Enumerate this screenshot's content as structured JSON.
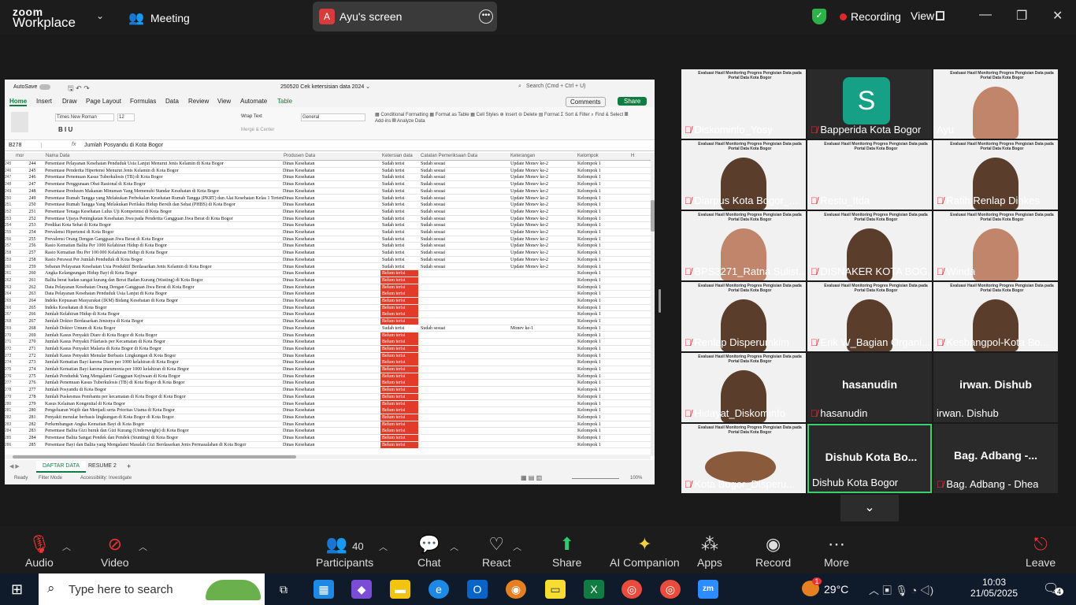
{
  "zoom": {
    "logo_line1": "zoom",
    "logo_line2": "Workplace",
    "meeting_label": "Meeting",
    "screen_label": "Ayu's screen",
    "screen_avatar": "A",
    "recording_label": "Recording",
    "view_label": "View"
  },
  "excel": {
    "autosave": "AutoSave",
    "file_title": "250520 Cek ketersisian data 2024 ⌄",
    "search": "Search (Cmd + Ctrl + U)",
    "tabs": [
      "Home",
      "Insert",
      "Draw",
      "Page Layout",
      "Formulas",
      "Data",
      "Review",
      "View",
      "Automate",
      "Table"
    ],
    "comments": "Comments",
    "share": "Share",
    "font_name": "Times New Roman",
    "font_size": "12",
    "wrap_text": "Wrap Text",
    "merge": "Merge & Center",
    "number_format": "General",
    "cell_ref": "B278",
    "formula": "Jumlah Posyandu di Kota Bogor",
    "col_headers": [
      "mor",
      "Nama Data",
      "Produsen Data",
      "Ketersian data",
      "Catatan Pemeriksaan Data",
      "Keterangan",
      "Kelompok",
      "H"
    ],
    "rows": [
      {
        "rn": "245",
        "no": "244",
        "nm": "Persentase Pelayanan Kesehatan Penduduk Usia Lanjut Menurut Jenis Kelamin di Kota Bogor",
        "pd": "Dinas Kesehatan",
        "kt": "Sudah terisi",
        "ct": "Sudah sesuai",
        "kg": "Update Monev ke-2",
        "kl": "Kelompok 1"
      },
      {
        "rn": "246",
        "no": "245",
        "nm": "Persentase Penderita Hipertensi Menurut Jenis Kelamin di Kota Bogor",
        "pd": "Dinas Kesehatan",
        "kt": "Sudah terisi",
        "ct": "Sudah sesuai",
        "kg": "Update Monev ke-2",
        "kl": "Kelompok 1"
      },
      {
        "rn": "247",
        "no": "246",
        "nm": "Persentase Penemuan Kasus Tuberkulosis (TB) di Kota Bogor",
        "pd": "Dinas Kesehatan",
        "kt": "Sudah terisi",
        "ct": "Sudah sesuai",
        "kg": "Update Monev ke-2",
        "kl": "Kelompok 1"
      },
      {
        "rn": "248",
        "no": "247",
        "nm": "Persentase Penggunaan Obat Rasional di Kota Bogor",
        "pd": "Dinas Kesehatan",
        "kt": "Sudah terisi",
        "ct": "Sudah sesuai",
        "kg": "Update Monev ke-2",
        "kl": "Kelompok 1"
      },
      {
        "rn": "249",
        "no": "248",
        "nm": "Persentase Produsen Makanan Minuman Yang Memenuhi Standar Kesehatan di Kota Bogor",
        "pd": "Dinas Kesehatan",
        "kt": "Sudah terisi",
        "ct": "Sudah sesuai",
        "kg": "Update Monev ke-2",
        "kl": "Kelompok 1"
      },
      {
        "rn": "250",
        "no": "249",
        "nm": "Persentase Rumah Tangga yang Melakukan Perbekalan Kesehatan Rumah Tangga (PKRT) dan Alat Kesehatan Kelas 1 Tertentu Yang Men",
        "pd": "Dinas Kesehatan",
        "kt": "Sudah terisi",
        "ct": "Sudah sesuai",
        "kg": "Update Monev ke-2",
        "kl": "Kelompok 1"
      },
      {
        "rn": "251",
        "no": "250",
        "nm": "Persentase Rumah Tangga Yang Melakukan Perilaku Hidup Bersih dan Sehat (PHBS) di Kota Bogor",
        "pd": "Dinas Kesehatan",
        "kt": "Sudah terisi",
        "ct": "Sudah sesuai",
        "kg": "Update Monev ke-2",
        "kl": "Kelompok 1"
      },
      {
        "rn": "252",
        "no": "251",
        "nm": "Persentase Tenaga Kesehatan Lulus Uji Kompetensi di Kota Bogor",
        "pd": "Dinas Kesehatan",
        "kt": "Sudah terisi",
        "ct": "Sudah sesuai",
        "kg": "Update Monev ke-2",
        "kl": "Kelompok 1"
      },
      {
        "rn": "253",
        "no": "252",
        "nm": "Persentase Upaya Peningkatan Kesehatan Jiwa pada Penderita Gangguan Jiwa Berat di Kota Bogor",
        "pd": "Dinas Kesehatan",
        "kt": "Sudah terisi",
        "ct": "Sudah sesuai",
        "kg": "Update Monev ke-2",
        "kl": "Kelompok 1"
      },
      {
        "rn": "254",
        "no": "253",
        "nm": "Predikat Kota Sehat di Kota Bogor",
        "pd": "Dinas Kesehatan",
        "kt": "Sudah terisi",
        "ct": "Sudah sesuai",
        "kg": "Update Monev ke-2",
        "kl": "Kelompok 1"
      },
      {
        "rn": "255",
        "no": "254",
        "nm": "Prevalensi Hipertensi di Kota Bogor",
        "pd": "Dinas Kesehatan",
        "kt": "Sudah terisi",
        "ct": "Sudah sesuai",
        "kg": "Update Monev ke-2",
        "kl": "Kelompok 1"
      },
      {
        "rn": "256",
        "no": "255",
        "nm": "Prevalensi Orang Dengan Gangguan Jiwa Berat di Kota Bogor",
        "pd": "Dinas Kesehatan",
        "kt": "Sudah terisi",
        "ct": "Sudah sesuai",
        "kg": "Update Monev ke-2",
        "kl": "Kelompok 1"
      },
      {
        "rn": "257",
        "no": "256",
        "nm": "Rasio Kematian Balita Per 1000 Kelahiran Hidup di Kota Bogor",
        "pd": "Dinas Kesehatan",
        "kt": "Sudah terisi",
        "ct": "Sudah sesuai",
        "kg": "Update Monev ke-2",
        "kl": "Kelompok 1"
      },
      {
        "rn": "258",
        "no": "257",
        "nm": "Rasio Kematian Ibu Per 100.000 Kelahiran Hidup di Kota Bogor",
        "pd": "Dinas Kesehatan",
        "kt": "Sudah terisi",
        "ct": "Sudah sesuai",
        "kg": "Update Monev ke-2",
        "kl": "Kelompok 1"
      },
      {
        "rn": "259",
        "no": "258",
        "nm": "Rasio Perawat Per Jumlah Penduduk di Kota Bogor",
        "pd": "Dinas Kesehatan",
        "kt": "Sudah terisi",
        "ct": "Sudah sesuai",
        "kg": "Update Monev ke-2",
        "kl": "Kelompok 1"
      },
      {
        "rn": "260",
        "no": "259",
        "nm": "Sebaran Pelayanan Kesehatan Usia Produktif Berdasarkan Jenis Kelamin di Kota Bogor",
        "pd": "Dinas Kesehatan",
        "kt": "Sudah terisi",
        "ct": "Sudah sesuai",
        "kg": "Update Monev ke-2",
        "kl": "Kelompok 1"
      },
      {
        "rn": "261",
        "no": "260",
        "nm": "Angka Kelangsungan Hidup Bayi di Kota Bogor",
        "pd": "Dinas Kesehatan",
        "kt": "Belum terisi",
        "ct": "",
        "kg": "",
        "kl": "Kelompok 1"
      },
      {
        "rn": "262",
        "no": "261",
        "nm": "Balita berat badan sangat kurang dan Berat Badan Kurang (Wasting) di Kota Bogor",
        "pd": "Dinas Kesehatan",
        "kt": "Belum terisi",
        "ct": "",
        "kg": "",
        "kl": "Kelompok 1"
      },
      {
        "rn": "263",
        "no": "262",
        "nm": "Data Pelayanan Kesehatan Orang Dengan Gangguan Jiwa Berat di Kota Bogor",
        "pd": "Dinas Kesehatan",
        "kt": "Belum terisi",
        "ct": "",
        "kg": "",
        "kl": "Kelompok 1"
      },
      {
        "rn": "264",
        "no": "263",
        "nm": "Data Pelayanan Kesehatan Penduduk Usia Lanjut di Kota Bogor",
        "pd": "Dinas Kesehatan",
        "kt": "Belum terisi",
        "ct": "",
        "kg": "",
        "kl": "Kelompok 1"
      },
      {
        "rn": "265",
        "no": "264",
        "nm": "Indeks Kepuasan Masyarakat (IKM) Bidang Kesehatan di Kota Bogor",
        "pd": "Dinas Kesehatan",
        "kt": "Belum terisi",
        "ct": "",
        "kg": "",
        "kl": "Kelompok 1"
      },
      {
        "rn": "266",
        "no": "265",
        "nm": "Indeks Kesehatan di Kota Bogor",
        "pd": "Dinas Kesehatan",
        "kt": "Belum terisi",
        "ct": "",
        "kg": "",
        "kl": "Kelompok 1"
      },
      {
        "rn": "267",
        "no": "266",
        "nm": "Jumlah Kelahiran Hidup di Kota Bogor",
        "pd": "Dinas Kesehatan",
        "kt": "Belum terisi",
        "ct": "",
        "kg": "",
        "kl": "Kelompok 1"
      },
      {
        "rn": "268",
        "no": "267",
        "nm": "Jumlah Dokter Berdasarkan Jenisnya di Kota Bogor",
        "pd": "Dinas Kesehatan",
        "kt": "Belum terisi",
        "ct": "",
        "kg": "",
        "kl": "Kelompok 1"
      },
      {
        "rn": "269",
        "no": "268",
        "nm": "Jumlah Dokter Umum di Kota Bogor",
        "pd": "Dinas Kesehatan",
        "kt": "Sudah terisi",
        "ct": "Sudah sesuai",
        "kg": "Monev ke-1",
        "kl": "Kelompok 1"
      },
      {
        "rn": "270",
        "no": "269",
        "nm": "Jumlah Kasus Penyakit Diare di Kota Bogor di Kota Bogor",
        "pd": "Dinas Kesehatan",
        "kt": "Belum terisi",
        "ct": "",
        "kg": "",
        "kl": "Kelompok 1"
      },
      {
        "rn": "271",
        "no": "270",
        "nm": "Jumlah Kasus Penyakit Filariasis per Kecamatan di Kota Bogor",
        "pd": "Dinas Kesehatan",
        "kt": "Belum terisi",
        "ct": "",
        "kg": "",
        "kl": "Kelompok 1"
      },
      {
        "rn": "272",
        "no": "271",
        "nm": "Jumlah Kasus Penyakit Malaria di Kota Bogor di Kota Bogor",
        "pd": "Dinas Kesehatan",
        "kt": "Belum terisi",
        "ct": "",
        "kg": "",
        "kl": "Kelompok 1"
      },
      {
        "rn": "273",
        "no": "272",
        "nm": "Jumlah Kasus Penyakit Menular Berbasis Lingkungan di Kota Bogor",
        "pd": "Dinas Kesehatan",
        "kt": "Belum terisi",
        "ct": "",
        "kg": "",
        "kl": "Kelompok 1"
      },
      {
        "rn": "274",
        "no": "273",
        "nm": "Jumlah Kematian Bayi karena Diare per 1000 kelahiran di Kota Bogor",
        "pd": "Dinas Kesehatan",
        "kt": "Belum terisi",
        "ct": "",
        "kg": "",
        "kl": "Kelompok 1"
      },
      {
        "rn": "275",
        "no": "274",
        "nm": "Jumlah Kematian Bayi karena pneumonia per 1000 kelahiran di Kota Bogor",
        "pd": "Dinas Kesehatan",
        "kt": "Belum terisi",
        "ct": "",
        "kg": "",
        "kl": "Kelompok 1"
      },
      {
        "rn": "276",
        "no": "275",
        "nm": "Jumlah Penduduk Yang Mengalami Gangguan Kejiwaan di Kota Bogor",
        "pd": "Dinas Kesehatan",
        "kt": "Belum terisi",
        "ct": "",
        "kg": "",
        "kl": "Kelompok 1"
      },
      {
        "rn": "277",
        "no": "276",
        "nm": "Jumlah Penemuan Kasus Tuberkulosis (TB) di Kota Bogor di Kota Bogor",
        "pd": "Dinas Kesehatan",
        "kt": "Belum terisi",
        "ct": "",
        "kg": "",
        "kl": "Kelompok 1"
      },
      {
        "rn": "278",
        "no": "277",
        "nm": "Jumlah Posyandu di Kota Bogor",
        "pd": "Dinas Kesehatan",
        "kt": "Belum terisi",
        "ct": "",
        "kg": "",
        "kl": "Kelompok 1"
      },
      {
        "rn": "279",
        "no": "278",
        "nm": "Jumlah Puskesmas Pembantu per kecamatan di Kota Bogor di Kota Bogor",
        "pd": "Dinas Kesehatan",
        "kt": "Belum terisi",
        "ct": "",
        "kg": "",
        "kl": "Kelompok 1"
      },
      {
        "rn": "280",
        "no": "279",
        "nm": "Kasus Kelainan Kongenital di Kota Bogor",
        "pd": "Dinas Kesehatan",
        "kt": "Belum terisi",
        "ct": "",
        "kg": "",
        "kl": "Kelompok 1"
      },
      {
        "rn": "281",
        "no": "280",
        "nm": "Pengeluaran Wajib dan Menjadi serta Prioritas Utama di Kota Bogor",
        "pd": "Dinas Kesehatan",
        "kt": "Belum terisi",
        "ct": "",
        "kg": "",
        "kl": "Kelompok 1"
      },
      {
        "rn": "282",
        "no": "281",
        "nm": "Penyakit menular berbasis lingkungan di Kota Bogor di Kota Bogor",
        "pd": "Dinas Kesehatan",
        "kt": "Belum terisi",
        "ct": "",
        "kg": "",
        "kl": "Kelompok 1"
      },
      {
        "rn": "283",
        "no": "282",
        "nm": "Perkembangan Angka Kematian Bayi di Kota Bogor",
        "pd": "Dinas Kesehatan",
        "kt": "Belum terisi",
        "ct": "",
        "kg": "",
        "kl": "Kelompok 1"
      },
      {
        "rn": "284",
        "no": "283",
        "nm": "Persentase Balita Gizi buruk dan Gizi Kurang (Underweight) di Kota Bogor",
        "pd": "Dinas Kesehatan",
        "kt": "Belum terisi",
        "ct": "",
        "kg": "",
        "kl": "Kelompok 1"
      },
      {
        "rn": "285",
        "no": "284",
        "nm": "Persentase Balita Sangat Pendek dan Pendek (Stunting) di Kota Bogor",
        "pd": "Dinas Kesehatan",
        "kt": "Belum terisi",
        "ct": "",
        "kg": "",
        "kl": "Kelompok 1"
      },
      {
        "rn": "286",
        "no": "285",
        "nm": "Persentase Bayi dan Balita yang Mengalami Masalah Gizi Berdasarkan Jenis Permasalahan di Kota Bogor",
        "pd": "Dinas Kesehatan",
        "kt": "Belum terisi",
        "ct": "",
        "kg": "",
        "kl": "Kelompok 1"
      }
    ],
    "sheets": [
      "DAFTAR DATA",
      "RESUME 2"
    ],
    "status_ready": "Ready",
    "status_filter": "Filter Mode",
    "status_access": "Accessibility: Investigate",
    "zoom_level": "100%"
  },
  "gallery": {
    "slide_title": "Evaluasi Hasil Monitoring Progres Pengisian Data pada Portal Data Kota Bogor",
    "tiles": [
      {
        "name": "Diskominfo_Yosy",
        "muted": true
      },
      {
        "name": "Bapperida Kota Bogor",
        "muted": true,
        "letter": "S"
      },
      {
        "name": "Ayu",
        "muted": false
      },
      {
        "name": "Diarpus Kota Bogor_...",
        "muted": true
      },
      {
        "name": "Restu_Itda",
        "muted": true
      },
      {
        "name": "Ratih Renlap Dinkes",
        "muted": true
      },
      {
        "name": "BPS3271_Ratna Sulist...",
        "muted": true
      },
      {
        "name": "DISNAKER KOTA BOG...",
        "muted": true
      },
      {
        "name": "Winda",
        "muted": true
      },
      {
        "name": "Renlap Disperumkim",
        "muted": true
      },
      {
        "name": "Erik W_Bagian Organi...",
        "muted": true
      },
      {
        "name": "Kesbangpol-Kota Bo...",
        "muted": true
      },
      {
        "name": "Hidayat_Diskominfo",
        "muted": true
      },
      {
        "name": "hasanudin",
        "muted": true,
        "center": "hasanudin"
      },
      {
        "name": "irwan. Dishub",
        "muted": false,
        "center": "irwan. Dishub"
      },
      {
        "name": "Kota Bogor_Disperu...",
        "muted": true
      },
      {
        "name": "Dishub Kota Bogor",
        "muted": false,
        "center": "Dishub Kota Bo..."
      },
      {
        "name": "Bag. Adbang - Dhea",
        "muted": true,
        "center": "Bag. Adbang -..."
      }
    ]
  },
  "controls": {
    "audio": "Audio",
    "video": "Video",
    "participants": "Participants",
    "participants_count": "40",
    "chat": "Chat",
    "react": "React",
    "share": "Share",
    "ai": "AI Companion",
    "apps": "Apps",
    "record": "Record",
    "more": "More",
    "leave": "Leave"
  },
  "taskbar": {
    "search_placeholder": "Type here to search",
    "temperature": "29°C",
    "weather_badge": "1",
    "time": "10:03",
    "date": "21/05/2025",
    "notif_count": "4"
  }
}
